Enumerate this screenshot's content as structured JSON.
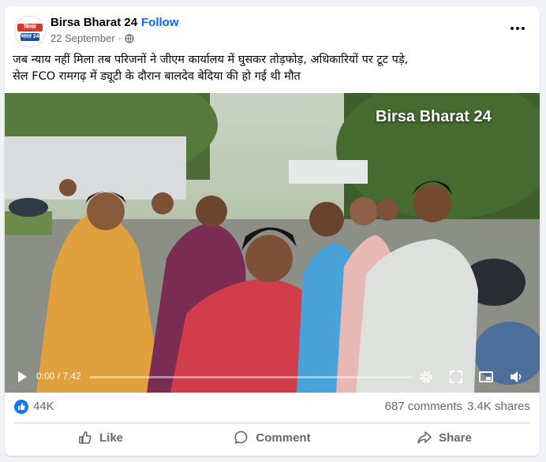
{
  "post": {
    "page_name": "Birsa Bharat 24",
    "separator": "·",
    "follow_label": "Follow",
    "date": "22 September",
    "date_separator": "·",
    "caption_line1": "जब न्याय नहीं मिला तब परिजनों ने जीएम कार्यालय में घुसकर तोड़फोड़, अधिकारियों पर टूट पड़े,",
    "caption_line2": "सेल FCO रामगढ़ में ड्यूटी के दौरान बालदेव बेदिया की हो गई थी मौत",
    "avatar_top": "बिरसा",
    "avatar_bottom": "भारत 24"
  },
  "video": {
    "watermark": "Birsa Bharat 24",
    "time": "0:00 / 7:42",
    "progress": 0.0
  },
  "reactions": {
    "like_count": "44K",
    "comments": "687 comments",
    "shares": "3.4K shares"
  },
  "actions": {
    "like": "Like",
    "comment": "Comment",
    "share": "Share"
  },
  "colors": {
    "accent": "#0866ff",
    "like_badge": "#1877f2",
    "muted_text": "#65676b"
  },
  "icons": [
    "globe-icon",
    "more-options-icon",
    "play-icon",
    "settings-icon",
    "fullscreen-icon",
    "miniplayer-icon",
    "volume-icon",
    "like-reaction-icon",
    "like-icon",
    "comment-icon",
    "share-icon"
  ]
}
